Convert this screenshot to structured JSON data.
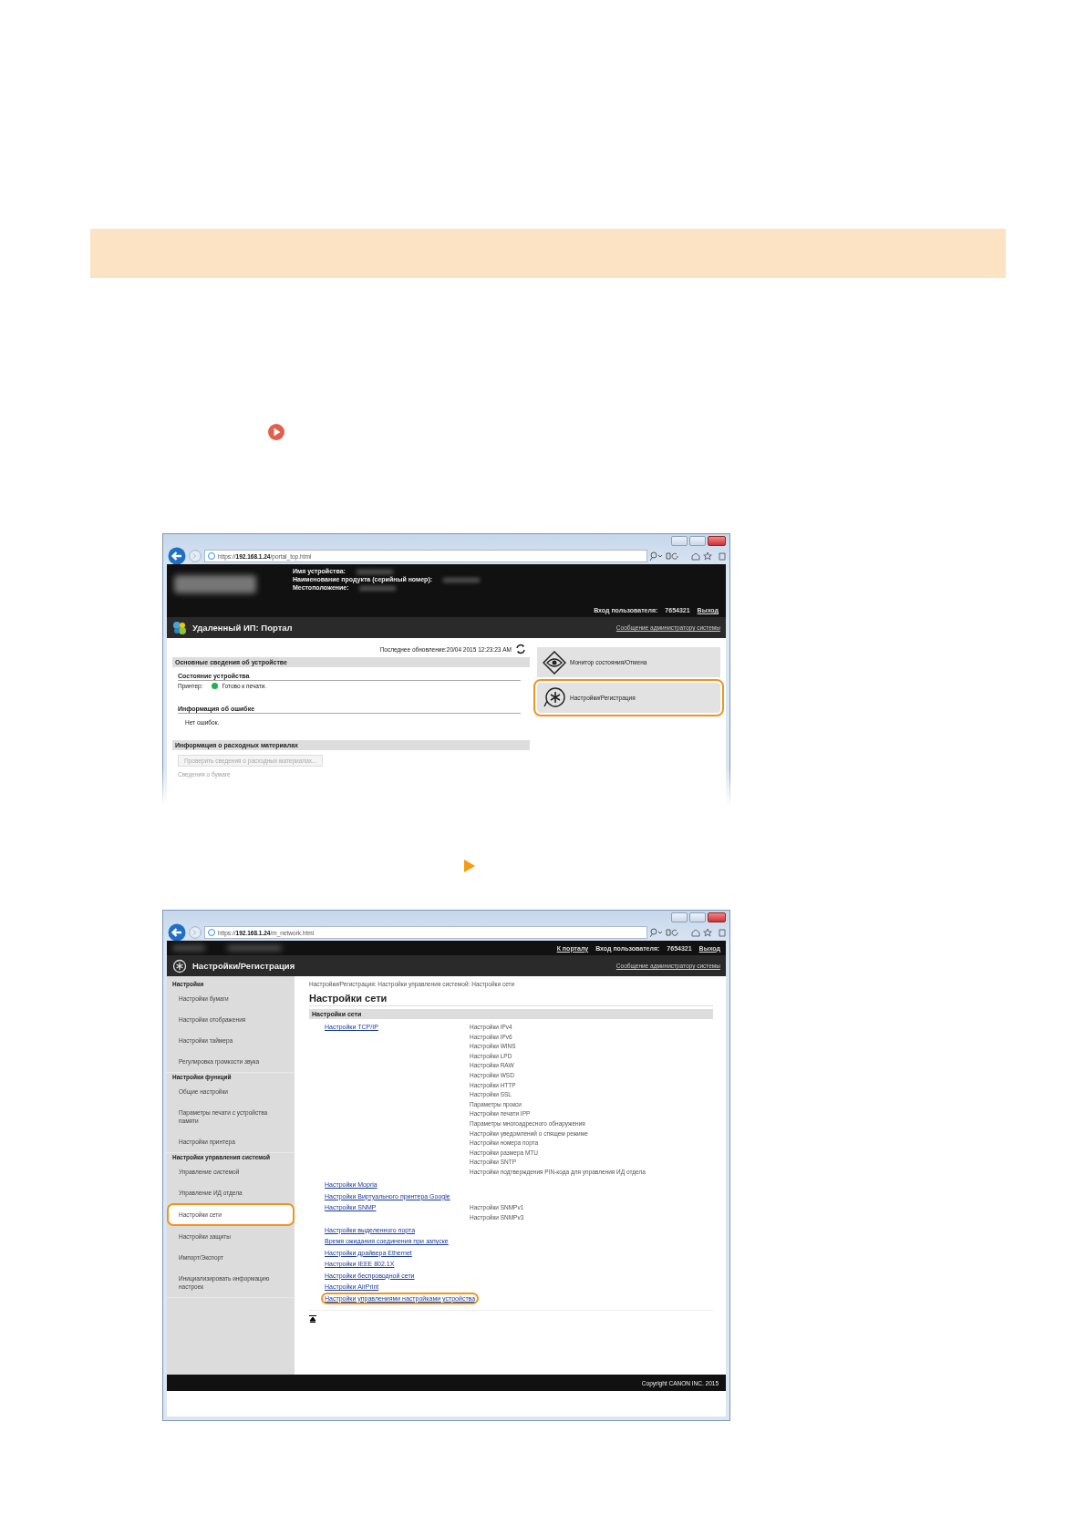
{
  "screenshot_portal": {
    "address": "https://**192.168.1.24**/portal_top.html",
    "device_labels": [
      "Имя устройства:",
      "Наименование продукта (серийный номер):",
      "Местоположение:"
    ],
    "login_label": "Вход пользователя:",
    "login_id": "7654321",
    "logout": "Выход",
    "title": "Удаленный ИП: Портал",
    "admin_link": "Сообщение администратору системы",
    "last_update": "Последнее обновление:20/04 2015 12:23:23 AM",
    "device_section": "Основные сведения об устройстве",
    "status_heading": "Состояние устройства",
    "printer_label": "Принтер:",
    "printer_status": {
      "text": "Готово к печати.",
      "color": "#22b14c"
    },
    "error_heading": "Информация об ошибке",
    "error_text": "Нет ошибок.",
    "supplies_section": "Информация о расходных материалах",
    "supplies_button": "Проверить сведения о расходных материалах...",
    "paper_info": "Сведения о бумаге",
    "menu_buttons": [
      {
        "label": "Монитор состояния/Отмена",
        "kind": "monitor",
        "highlighted": false
      },
      {
        "label": "Настройки/Регистрация",
        "kind": "settings",
        "highlighted": true
      }
    ]
  },
  "screenshot_network": {
    "address": "https://**192.168.1.24**/m_network.html",
    "portal_link": "К порталу",
    "login_label": "Вход пользователя:",
    "login_id": "7654321",
    "logout": "Выход",
    "title": "Настройки/Регистрация",
    "admin_link": "Сообщение администратору системы",
    "sidebar": [
      {
        "heading": "Настройки",
        "items": [
          {
            "label": "Настройки бумаги",
            "selected": false
          },
          {
            "label": "Настройки отображения",
            "selected": false
          },
          {
            "label": "Настройки таймера",
            "selected": false
          },
          {
            "label": "Регулировка громкости звука",
            "selected": false
          }
        ]
      },
      {
        "heading": "Настройки функций",
        "items": [
          {
            "label": "Общие настройки",
            "selected": false
          },
          {
            "label": "Параметры печати с устройства памяти",
            "selected": false
          },
          {
            "label": "Настройки принтера",
            "selected": false
          }
        ]
      },
      {
        "heading": "Настройки управления системой",
        "items": [
          {
            "label": "Управление системой",
            "selected": false
          },
          {
            "label": "Управление ИД отдела",
            "selected": false
          },
          {
            "label": "Настройки сети",
            "selected": true
          },
          {
            "label": "Настройки защиты",
            "selected": false
          },
          {
            "label": "Импорт/Экспорт",
            "selected": false
          },
          {
            "label": "Инициализировать информацию настроек",
            "selected": false
          }
        ]
      }
    ],
    "breadcrumb": "Настройки/Регистрация: Настройки управления системой: Настройки сети",
    "heading": "Настройки сети",
    "section": "Настройки сети",
    "links": [
      {
        "label": "Настройки TCP/IP",
        "highlighted": false,
        "sub_items": [
          "Настройки IPv4",
          "Настройки IPv6",
          "Настройки WINS",
          "Настройки LPD",
          "Настройки RAW",
          "Настройки WSD",
          "Настройки HTTP",
          "Настройки SSL",
          "Параметры прокси",
          "Настройки печати IPP",
          "Параметры многоадресного обнаружения",
          "Настройки уведомлений о спящем режиме",
          "Настройки номера порта",
          "Настройки размера MTU",
          "Настройки SNTP",
          "Настройки подтверждения PIN-кода для управления ИД отдела"
        ]
      },
      {
        "label": "Настройки Mopria",
        "highlighted": false
      },
      {
        "label": "Настройки Виртуального принтера Google",
        "highlighted": false
      },
      {
        "label": "Настройки SNMP",
        "highlighted": false,
        "sub_items": [
          "Настройки SNMPv1",
          "Настройки SNMPv3"
        ]
      },
      {
        "label": "Настройки выделенного порта",
        "highlighted": false
      },
      {
        "label": "Время ожидания соединения при запуске",
        "highlighted": false
      },
      {
        "label": "Настройки драйвера Ethernet",
        "highlighted": false
      },
      {
        "label": "Настройки IEEE 802.1X",
        "highlighted": false
      },
      {
        "label": "Настройки беспроводной сети",
        "highlighted": false
      },
      {
        "label": "Настройки AirPrint",
        "highlighted": false
      },
      {
        "label": "Настройки управлениями настройками устройства",
        "highlighted": true
      }
    ],
    "copyright": "Copyright CANON INC. 2015"
  }
}
